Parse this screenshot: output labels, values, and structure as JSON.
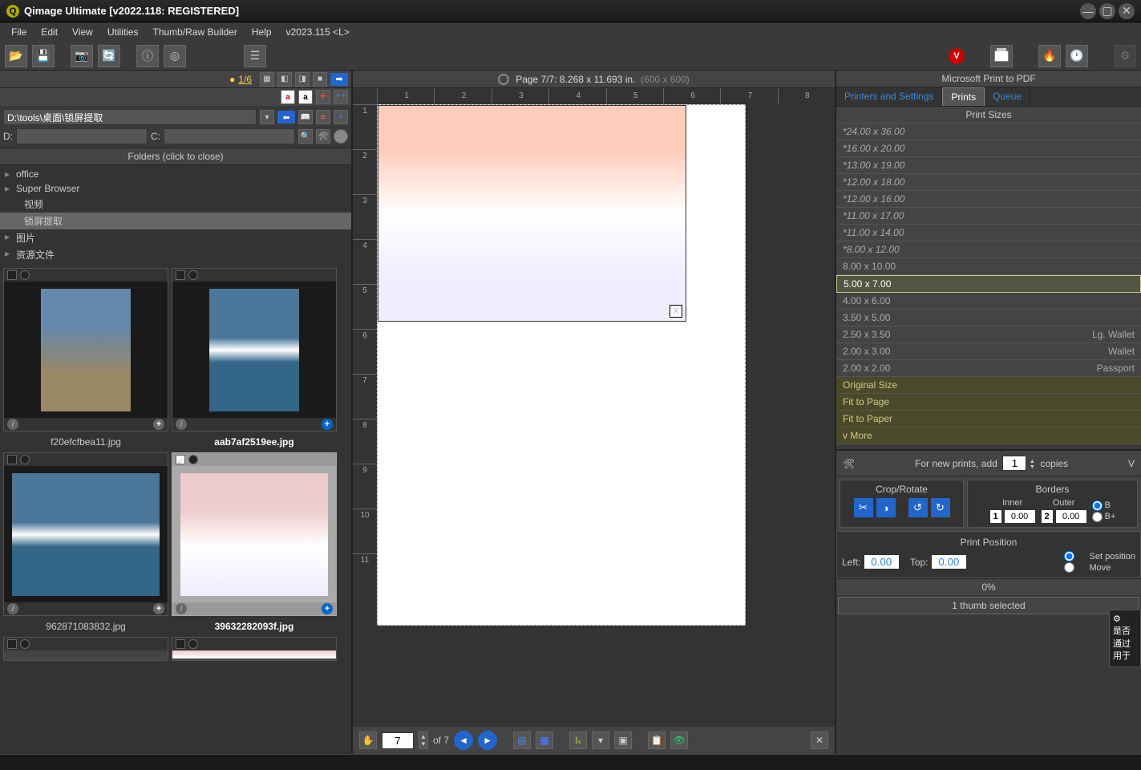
{
  "window": {
    "title": "Qimage Ultimate [v2022.118: REGISTERED]"
  },
  "menu": [
    "File",
    "Edit",
    "View",
    "Utilities",
    "Thumb/Raw Builder",
    "Help",
    "v2023.115 <L>"
  ],
  "left": {
    "counter": "1/6",
    "path": "D:\\tools\\桌面\\锁屏提取",
    "dlabel": "D:",
    "clabel": "C:",
    "folders_header": "Folders (click to close)",
    "folders": [
      {
        "name": "office",
        "level": 1
      },
      {
        "name": "Super Browser",
        "level": 1
      },
      {
        "name": "视频",
        "level": 2
      },
      {
        "name": "锁屏提取",
        "level": 2,
        "selected": true
      },
      {
        "name": "图片",
        "level": 1
      },
      {
        "name": "资源文件",
        "level": 1
      }
    ],
    "thumbs": [
      {
        "name": "f20efcfbea11.jpg",
        "type": "paint",
        "portrait": true,
        "sel": false
      },
      {
        "name": "aab7af2519ee.jpg",
        "type": "water",
        "portrait": true,
        "sel": false,
        "bold": true
      },
      {
        "name": "962871083832.jpg",
        "type": "water",
        "portrait": false,
        "sel": false
      },
      {
        "name": "39632282093f.jpg",
        "type": "snow",
        "portrait": false,
        "sel": true,
        "bold": true
      }
    ]
  },
  "center": {
    "page_label": "Page 7/7: 8.268 x 11.693 in.",
    "page_dims": "(600 x 600)",
    "ruler_h": [
      "1",
      "2",
      "3",
      "4",
      "5",
      "6",
      "7",
      "8"
    ],
    "ruler_v": [
      "1",
      "2",
      "3",
      "4",
      "5",
      "6",
      "7",
      "8",
      "9",
      "10",
      "11"
    ],
    "close_x": "X",
    "page_input": "7",
    "page_of": "of 7"
  },
  "right": {
    "printer": "Microsoft Print to PDF",
    "tabs": [
      "Printers and Settings",
      "Prints",
      "Queue"
    ],
    "active_tab": 1,
    "sizes_header": "Print Sizes",
    "sizes": [
      {
        "label": "*24.00 x 36.00",
        "star": true
      },
      {
        "label": "*16.00 x 20.00",
        "star": true
      },
      {
        "label": "*13.00 x 19.00",
        "star": true
      },
      {
        "label": "*12.00 x 18.00",
        "star": true
      },
      {
        "label": "*12.00 x 16.00",
        "star": true
      },
      {
        "label": "*11.00 x 17.00",
        "star": true
      },
      {
        "label": "*11.00 x 14.00",
        "star": true
      },
      {
        "label": "*8.00 x 12.00",
        "star": true
      },
      {
        "label": "8.00 x 10.00"
      },
      {
        "label": "5.00 x 7.00",
        "sel": true
      },
      {
        "label": "4.00 x 6.00"
      },
      {
        "label": "3.50 x 5.00"
      },
      {
        "label": "2.50 x 3.50",
        "right": "Lg. Wallet"
      },
      {
        "label": "2.00 x 3.00",
        "right": "Wallet"
      },
      {
        "label": "2.00 x 2.00",
        "right": "Passport"
      },
      {
        "label": "Original Size",
        "special": true
      },
      {
        "label": "Fit to Page",
        "special": true
      },
      {
        "label": "Fit to Paper",
        "special": true
      },
      {
        "label": "v More",
        "special": true
      }
    ],
    "copies_label_pre": "For new prints, add",
    "copies_value": "1",
    "copies_label_post": "copies",
    "crop_header": "Crop/Rotate",
    "borders_header": "Borders",
    "inner_label": "Inner",
    "outer_label": "Outer",
    "inner_value": "0.00",
    "outer_value": "0.00",
    "b_label": "B",
    "bplus_label": "B+",
    "pos_header": "Print Position",
    "left_label": "Left:",
    "left_value": "0.00",
    "top_label": "Top:",
    "top_value": "0.00",
    "setpos_label": "Set position",
    "move_label": "Move",
    "progress": "0%",
    "status": "1 thumb selected"
  },
  "overlay": {
    "l1": "是否",
    "l2": "通过",
    "l3": "用于"
  }
}
